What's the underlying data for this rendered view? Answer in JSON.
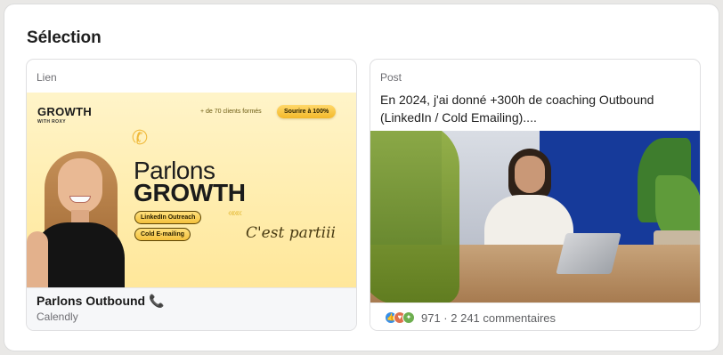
{
  "section": {
    "title": "Sélection"
  },
  "cards": [
    {
      "kind": "Lien",
      "banner": {
        "brand": "GROWTH",
        "brand_sub": "WITH ROXY",
        "clients_note": "+ de 70 clients formés",
        "smile_label": "Sourire à 100%",
        "headline_1": "Parlons",
        "headline_2": "GROWTH",
        "chevrons": "«««",
        "pill_1": "LinkedIn Outreach",
        "pill_2": "Cold E-mailing",
        "script_text": "C'est partiii"
      },
      "title": "Parlons Outbound 📞",
      "subtitle": "Calendly"
    },
    {
      "kind": "Post",
      "text": "En 2024, j'ai donné +300h de coaching Outbound (LinkedIn / Cold Emailing)....",
      "reactions": {
        "icons": [
          "like-icon",
          "love-icon",
          "celebrate-icon"
        ],
        "stats": "971 · 2 241 commentaires"
      }
    }
  ],
  "colors": {
    "accent_yellow": "#f4c13d",
    "photo_blue": "#1b41a3"
  }
}
